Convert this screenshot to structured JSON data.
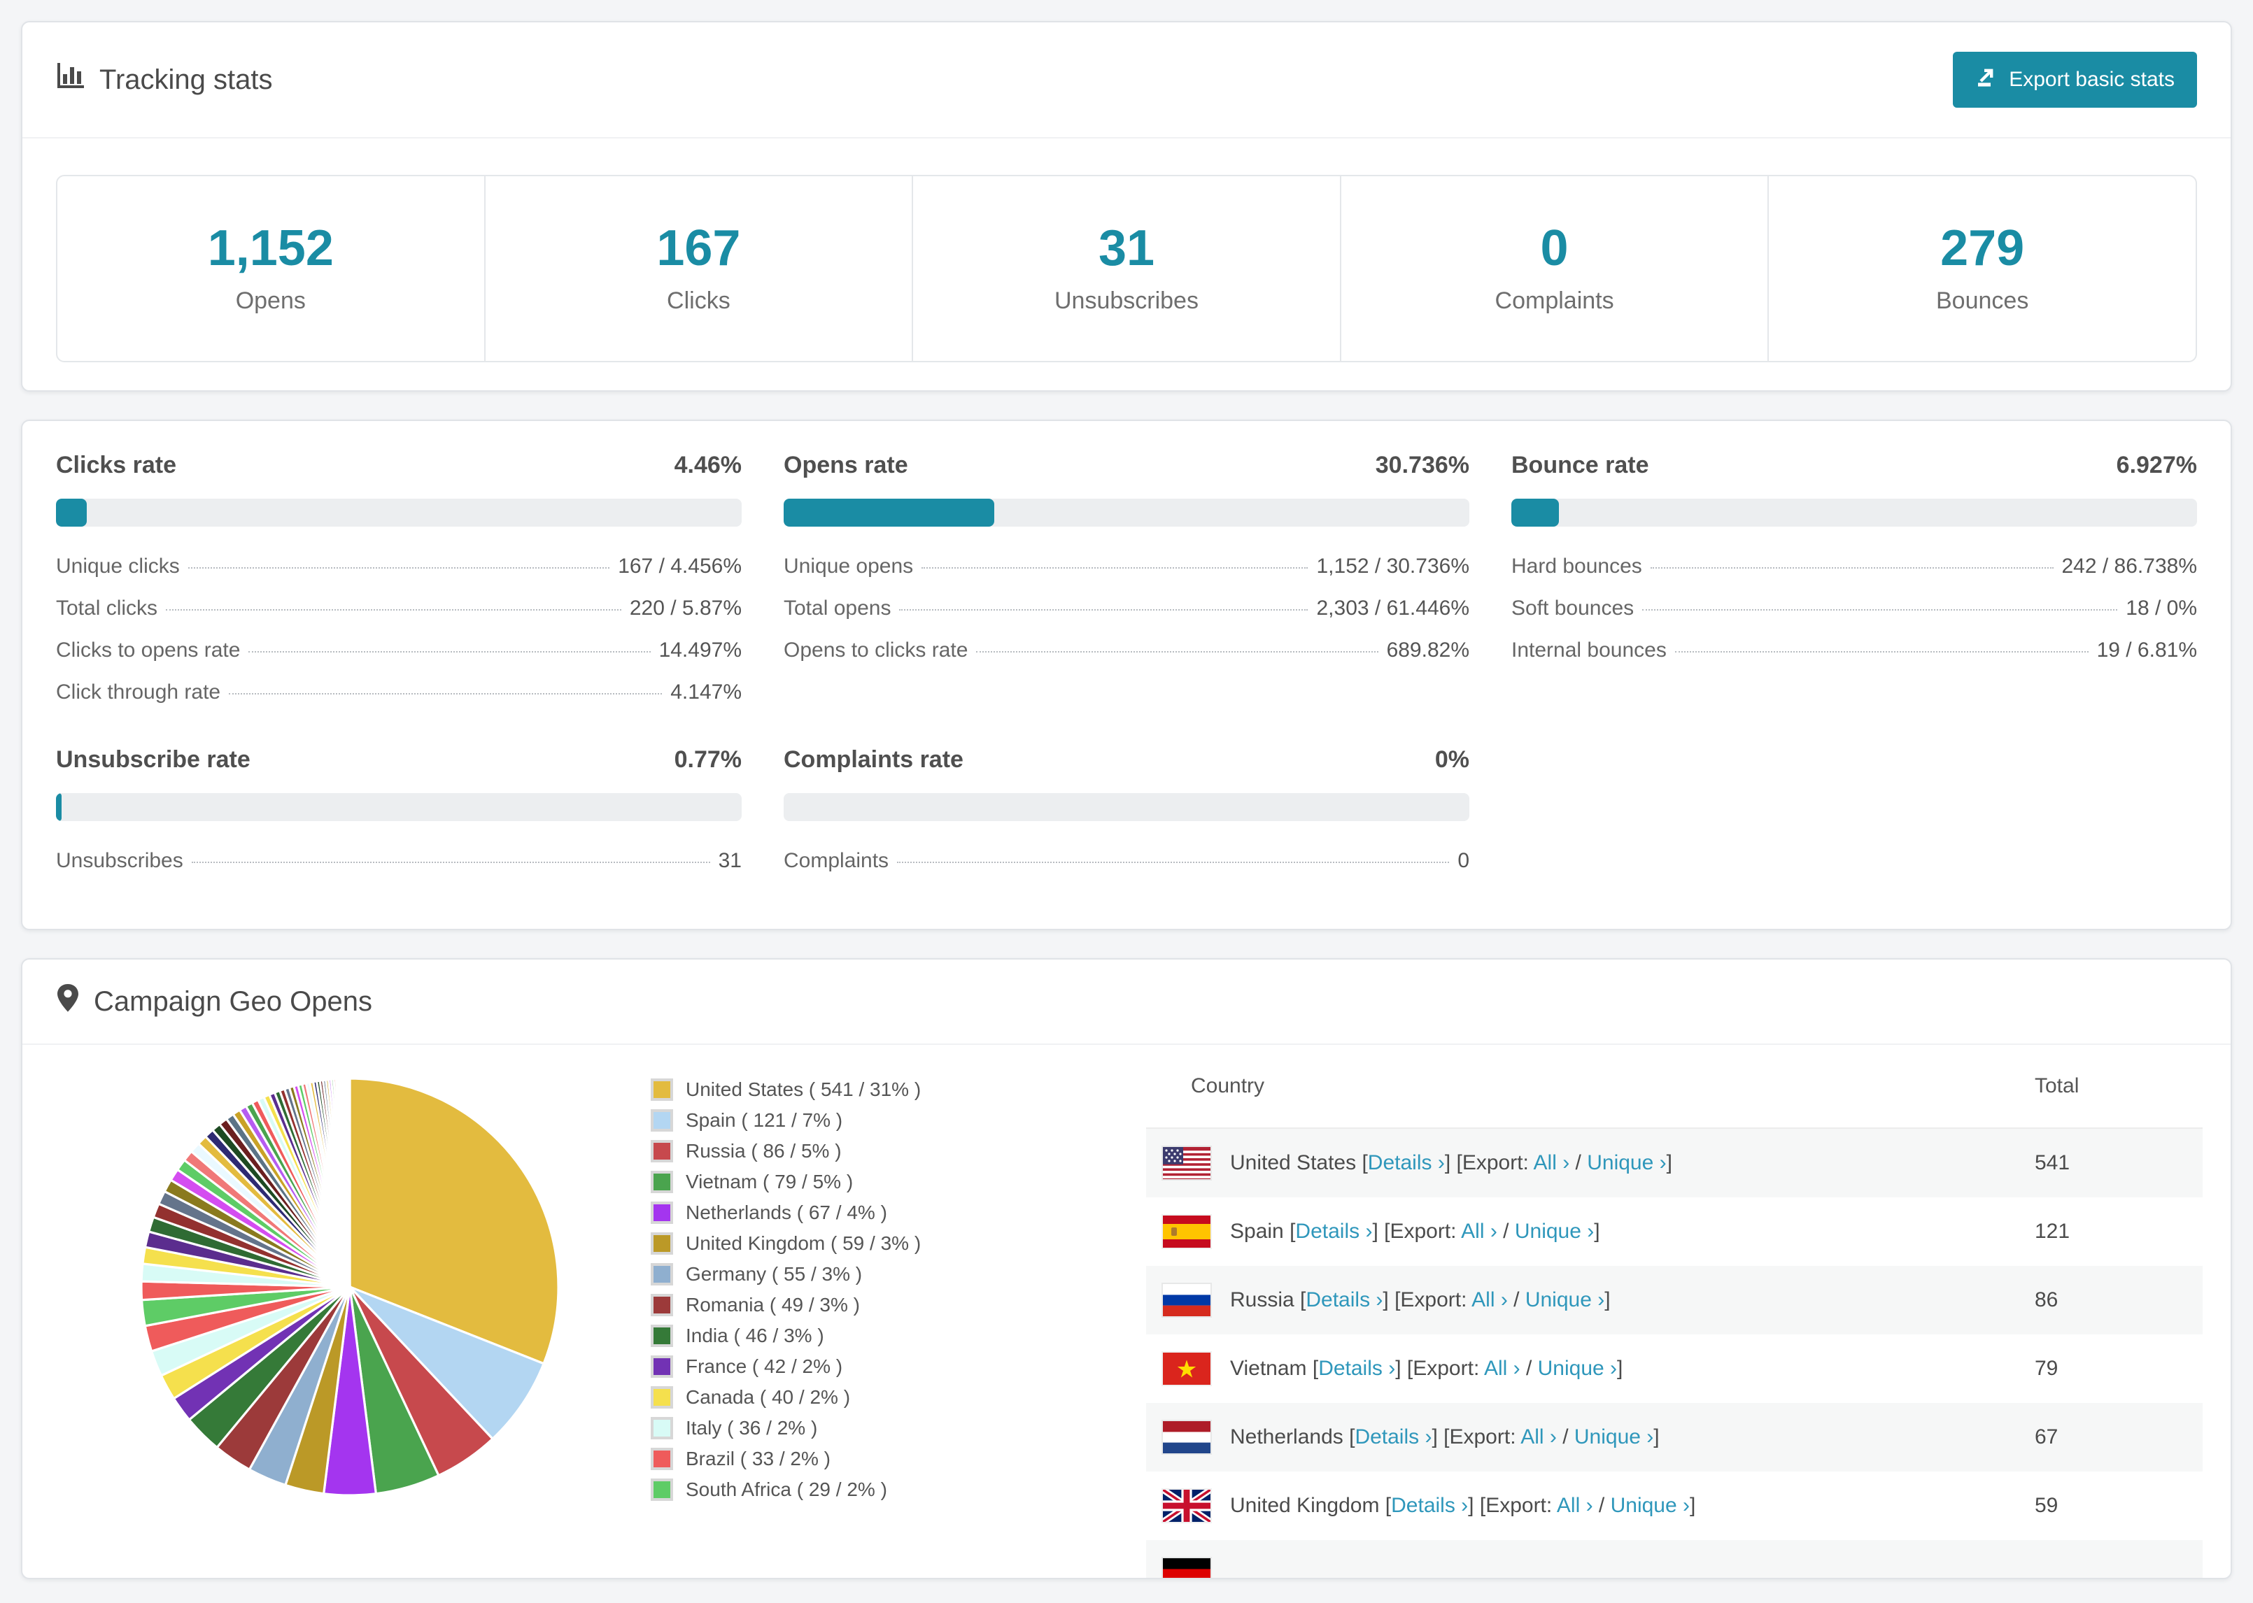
{
  "colors": {
    "accent": "#1a8ca4",
    "link": "#2f97bb",
    "bar_track": "#eceef0"
  },
  "tracking": {
    "title": "Tracking stats",
    "export_button": "Export basic stats",
    "summary": [
      {
        "value": "1,152",
        "label": "Opens"
      },
      {
        "value": "167",
        "label": "Clicks"
      },
      {
        "value": "31",
        "label": "Unsubscribes"
      },
      {
        "value": "0",
        "label": "Complaints"
      },
      {
        "value": "279",
        "label": "Bounces"
      }
    ]
  },
  "rates": [
    {
      "title": "Clicks rate",
      "value": "4.46%",
      "percent": 4.46,
      "rows": [
        [
          "Unique clicks",
          "167 / 4.456%"
        ],
        [
          "Total clicks",
          "220 / 5.87%"
        ],
        [
          "Clicks to opens rate",
          "14.497%"
        ],
        [
          "Click through rate",
          "4.147%"
        ]
      ]
    },
    {
      "title": "Opens rate",
      "value": "30.736%",
      "percent": 30.736,
      "rows": [
        [
          "Unique opens",
          "1,152 / 30.736%"
        ],
        [
          "Total opens",
          "2,303 / 61.446%"
        ],
        [
          "Opens to clicks rate",
          "689.82%"
        ]
      ]
    },
    {
      "title": "Bounce rate",
      "value": "6.927%",
      "percent": 6.927,
      "rows": [
        [
          "Hard bounces",
          "242 / 86.738%"
        ],
        [
          "Soft bounces",
          "18 / 0%"
        ],
        [
          "Internal bounces",
          "19 / 6.81%"
        ]
      ]
    },
    {
      "title": "Unsubscribe rate",
      "value": "0.77%",
      "percent": 0.77,
      "rows": [
        [
          "Unsubscribes",
          "31"
        ]
      ]
    },
    {
      "title": "Complaints rate",
      "value": "0%",
      "percent": 0,
      "rows": [
        [
          "Complaints",
          "0"
        ]
      ]
    }
  ],
  "geo": {
    "title": "Campaign Geo Opens",
    "table": {
      "columns": [
        "Country",
        "Total"
      ],
      "link_labels": {
        "details": "Details ›",
        "export": "Export:",
        "all": "All ›",
        "unique": "Unique ›"
      },
      "rows": [
        {
          "country": "United States",
          "flag": "us",
          "total": "541",
          "partial": false
        },
        {
          "country": "Spain",
          "flag": "es",
          "total": "121",
          "partial": false
        },
        {
          "country": "Russia",
          "flag": "ru",
          "total": "86",
          "partial": false
        },
        {
          "country": "Vietnam",
          "flag": "vn",
          "total": "79",
          "partial": false
        },
        {
          "country": "Netherlands",
          "flag": "nl",
          "total": "67",
          "partial": false
        },
        {
          "country": "United Kingdom",
          "flag": "gb",
          "total": "59",
          "partial": false
        },
        {
          "country": "",
          "flag": "de",
          "total": "",
          "partial": true
        }
      ]
    }
  },
  "chart_data": {
    "type": "pie",
    "title": "Campaign Geo Opens",
    "legend_position": "right",
    "start_angle_deg": 0,
    "direction": "clockwise",
    "series": [
      {
        "name": "United States",
        "count": 541,
        "percent": 31,
        "color": "#e3bb3f"
      },
      {
        "name": "Spain",
        "count": 121,
        "percent": 7,
        "color": "#b3d6f2"
      },
      {
        "name": "Russia",
        "count": 86,
        "percent": 5,
        "color": "#c7494d"
      },
      {
        "name": "Vietnam",
        "count": 79,
        "percent": 5,
        "color": "#4aa44e"
      },
      {
        "name": "Netherlands",
        "count": 67,
        "percent": 4,
        "color": "#a435ef"
      },
      {
        "name": "United Kingdom",
        "count": 59,
        "percent": 3,
        "color": "#bb9927"
      },
      {
        "name": "Germany",
        "count": 55,
        "percent": 3,
        "color": "#8fafcf"
      },
      {
        "name": "Romania",
        "count": 49,
        "percent": 3,
        "color": "#9c3a3a"
      },
      {
        "name": "India",
        "count": 46,
        "percent": 3,
        "color": "#357a38"
      },
      {
        "name": "France",
        "count": 42,
        "percent": 2,
        "color": "#7232b4"
      },
      {
        "name": "Canada",
        "count": 40,
        "percent": 2,
        "color": "#f5e04d"
      },
      {
        "name": "Italy",
        "count": 36,
        "percent": 2,
        "color": "#d8fbf6"
      },
      {
        "name": "Brazil",
        "count": 33,
        "percent": 2,
        "color": "#ef5b5b"
      },
      {
        "name": "South Africa",
        "count": 29,
        "percent": 2,
        "color": "#5ecc66"
      }
    ],
    "others_unlabeled": {
      "percent_total": 36,
      "slice_count": 48,
      "decay": 0.95,
      "palette": [
        "#ef5b5b",
        "#d8fbf6",
        "#f5e04d",
        "#5b2d8e",
        "#2f6b33",
        "#93312f",
        "#64748b",
        "#8a7a1e",
        "#d44df0",
        "#5ecc66",
        "#f07878",
        "#eaf9ff",
        "#e3bb3f",
        "#2e2a72",
        "#1d4a22",
        "#6b1f1f",
        "#5b7386",
        "#c9a227",
        "#b65cf0",
        "#4aa44e"
      ]
    }
  }
}
